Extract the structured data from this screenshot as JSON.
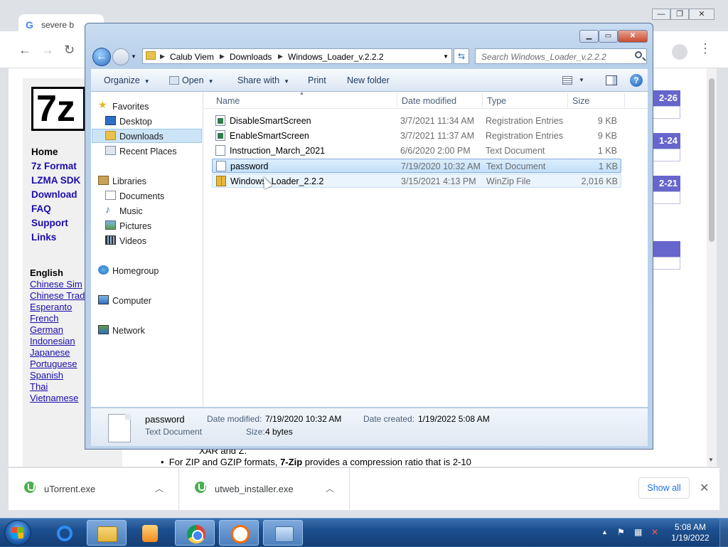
{
  "browser": {
    "active_tab": "severe b",
    "window_controls": {
      "minimize": "—",
      "maximize": "❐",
      "close": "✕"
    }
  },
  "site": {
    "logo": "7z",
    "nav": [
      "Home",
      "7z Format",
      "LZMA SDK",
      "Download",
      "FAQ",
      "Support",
      "Links"
    ],
    "lang_title": "English",
    "languages": [
      "Chinese Sim",
      "Chinese Trad",
      "Esperanto",
      "French",
      "German",
      "Indonesian",
      "Japanese",
      "Portuguese",
      "Spanish",
      "Thai",
      "Vietnamese"
    ],
    "dates": [
      "2-26",
      "1-24",
      "2-21"
    ],
    "body_line1": "XAR and Z.",
    "body_bullet_prefix": "For ZIP and GZIP formats, ",
    "body_bullet_bold": "7-Zip",
    "body_bullet_suffix": " provides a compression ratio that is 2-10"
  },
  "downloads": {
    "items": [
      {
        "label": "uTorrent.exe"
      },
      {
        "label": "utweb_installer.exe"
      }
    ],
    "show_all": "Show all",
    "close": "✕"
  },
  "explorer": {
    "breadcrumb": [
      "Calub Viem",
      "Downloads",
      "Windows_Loader_v.2.2.2"
    ],
    "search_placeholder": "Search Windows_Loader_v.2.2.2",
    "commands": {
      "organize": "Organize",
      "open": "Open",
      "share": "Share with",
      "print": "Print",
      "new_folder": "New folder"
    },
    "nav": {
      "favorites": "Favorites",
      "desktop": "Desktop",
      "downloads": "Downloads",
      "recent": "Recent Places",
      "libraries": "Libraries",
      "documents": "Documents",
      "music": "Music",
      "pictures": "Pictures",
      "videos": "Videos",
      "homegroup": "Homegroup",
      "computer": "Computer",
      "network": "Network"
    },
    "columns": {
      "name": "Name",
      "date": "Date modified",
      "type": "Type",
      "size": "Size"
    },
    "files": [
      {
        "name": "DisableSmartScreen",
        "date": "3/7/2021 11:34 AM",
        "type": "Registration Entries",
        "size": "9 KB",
        "icon": "registry-icon"
      },
      {
        "name": "EnableSmartScreen",
        "date": "3/7/2021 11:37 AM",
        "type": "Registration Entries",
        "size": "9 KB",
        "icon": "registry-icon"
      },
      {
        "name": "Instruction_March_2021",
        "date": "6/6/2020 2:00 PM",
        "type": "Text Document",
        "size": "1 KB",
        "icon": "text-file-icon"
      },
      {
        "name": "password",
        "date": "7/19/2020 10:32 AM",
        "type": "Text Document",
        "size": "1 KB",
        "icon": "text-file-icon"
      },
      {
        "name": "Windows_Loader_2.2.2",
        "date": "3/15/2021 4:13 PM",
        "type": "WinZip File",
        "size": "2,016 KB",
        "icon": "zip-file-icon"
      }
    ],
    "details": {
      "name": "password",
      "type": "Text Document",
      "date_modified_label": "Date modified:",
      "date_modified": "7/19/2020 10:32 AM",
      "date_created_label": "Date created:",
      "date_created": "1/19/2022 5:08 AM",
      "size_label": "Size:",
      "size": "4 bytes"
    }
  },
  "taskbar": {
    "time": "5:08 AM",
    "date": "1/19/2022"
  }
}
